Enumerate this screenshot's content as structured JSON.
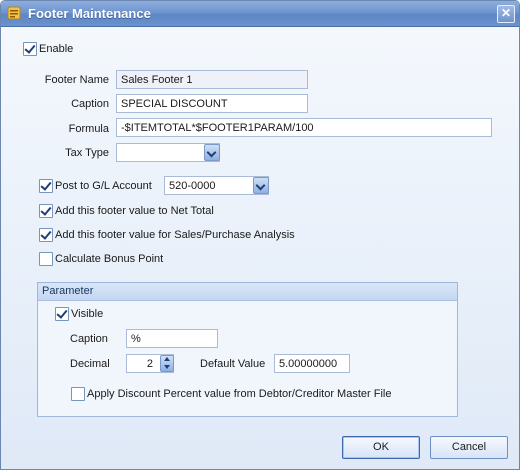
{
  "window": {
    "title": "Footer Maintenance",
    "close_glyph": "✕"
  },
  "enable": {
    "label": "Enable",
    "checked": true
  },
  "footer_name": {
    "label": "Footer Name",
    "value": "Sales Footer 1"
  },
  "caption": {
    "label": "Caption",
    "value": "SPECIAL DISCOUNT"
  },
  "formula": {
    "label": "Formula",
    "value": "-$ITEMTOTAL*$FOOTER1PARAM/100"
  },
  "tax_type": {
    "label": "Tax Type",
    "value": ""
  },
  "post_gl": {
    "label": "Post to G/L Account",
    "checked": true,
    "account": "520-0000"
  },
  "net_total": {
    "label": "Add this footer value to Net Total",
    "checked": true
  },
  "sales_analysis": {
    "label": "Add this footer value for Sales/Purchase Analysis",
    "checked": true
  },
  "bonus_point": {
    "label": "Calculate Bonus Point",
    "checked": false
  },
  "parameter": {
    "title": "Parameter",
    "visible": {
      "label": "Visible",
      "checked": true
    },
    "caption": {
      "label": "Caption",
      "value": "%"
    },
    "decimal": {
      "label": "Decimal",
      "value": "2"
    },
    "default_value": {
      "label": "Default Value",
      "value": "5.00000000"
    },
    "apply_discount": {
      "label": "Apply Discount Percent value from Debtor/Creditor Master File",
      "checked": false
    }
  },
  "buttons": {
    "ok": "OK",
    "cancel": "Cancel"
  },
  "colors": {
    "titlebar": "#6f95cf",
    "accent": "#3c67ad",
    "background": "#eaf1fb"
  }
}
